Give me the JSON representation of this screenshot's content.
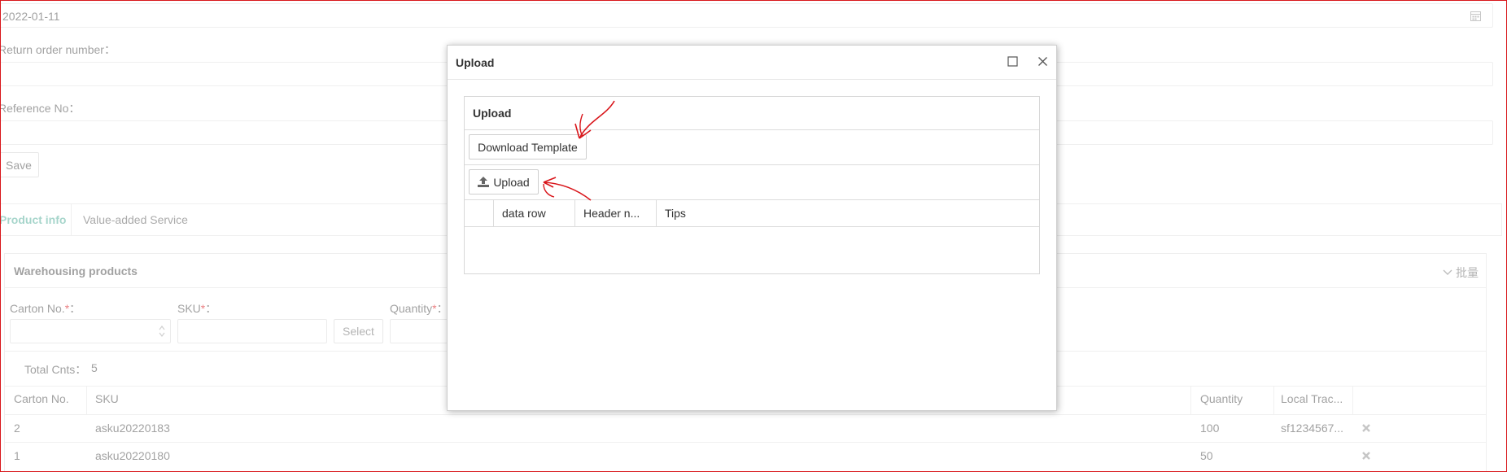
{
  "form": {
    "date_value": "2022-01-11",
    "return_order_label": "Return order number：",
    "reference_label": "Reference No：",
    "save_label": "Save"
  },
  "tabs": [
    {
      "label": "Product info",
      "active": true
    },
    {
      "label": "Value-added Service",
      "active": false
    }
  ],
  "warehousing": {
    "title": "Warehousing products",
    "batch_label": "批量",
    "carton_label": "Carton No.",
    "sku_label": "SKU",
    "quantity_label": "Quantity",
    "required_mark": "*",
    "colon": "：",
    "select_label": "Select",
    "total_label": "Total Cnts：",
    "total_value": "5",
    "columns": [
      "Carton No.",
      "SKU",
      "Quantity",
      "Local Trac..."
    ],
    "rows": [
      {
        "carton": "2",
        "sku": "asku20220183",
        "quantity": "100",
        "tracking": "sf1234567..."
      },
      {
        "carton": "1",
        "sku": "asku20220180",
        "quantity": "50",
        "tracking": ""
      }
    ]
  },
  "modal": {
    "title": "Upload",
    "section_title": "Upload",
    "download_template_label": "Download Template",
    "upload_label": "Upload",
    "columns": [
      "",
      "data row",
      "Header n...",
      "Tips"
    ]
  },
  "colors": {
    "accent": "#5fb3a1",
    "annotation": "#d9161b"
  }
}
